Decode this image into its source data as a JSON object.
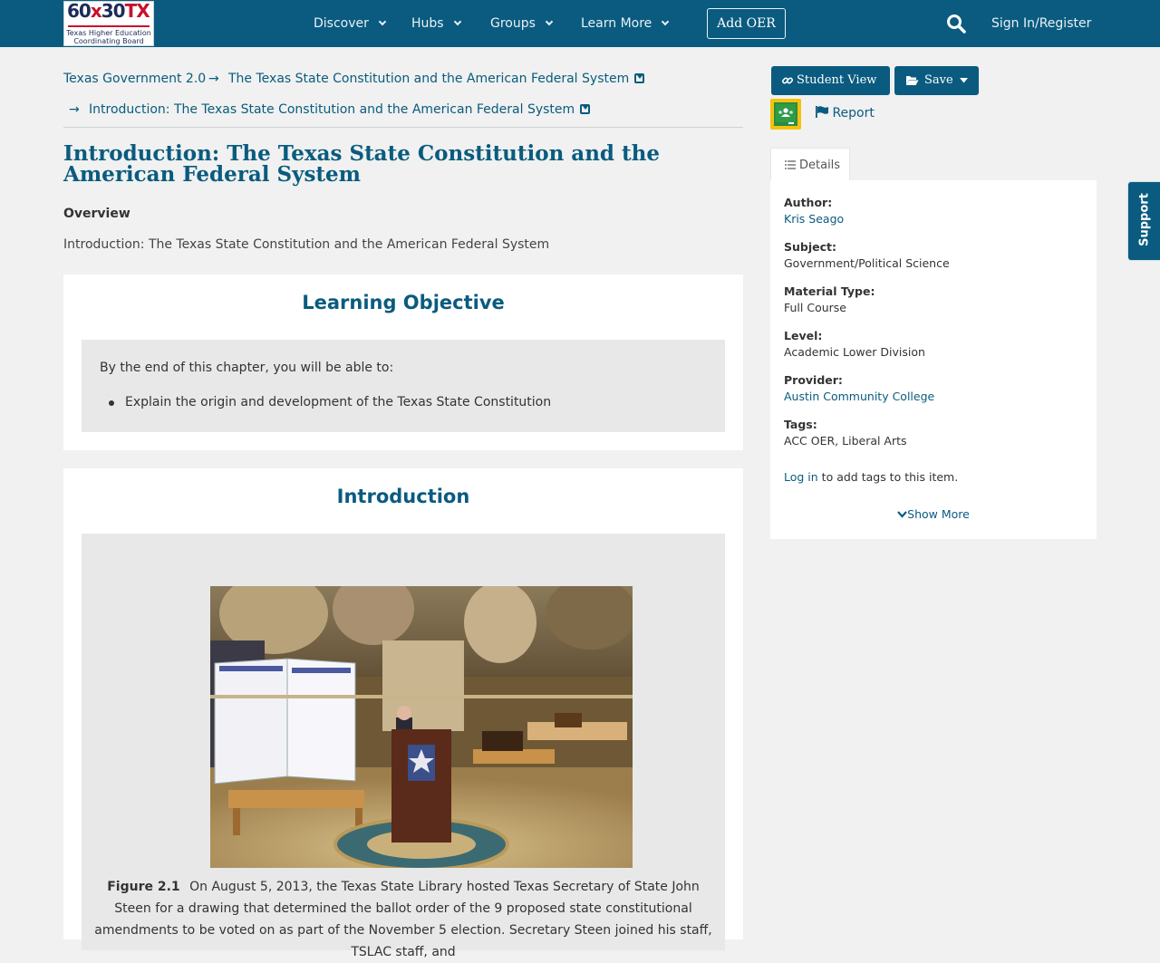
{
  "brand": {
    "logo_big_left": "60",
    "logo_big_x": "x",
    "logo_big_mid": "30",
    "logo_big_right": "TX",
    "logo_line1": "Texas Higher Education",
    "logo_line2": "Coordinating Board"
  },
  "nav": {
    "items": [
      "Discover",
      "Hubs",
      "Groups",
      "Learn More"
    ],
    "add_oer": "Add OER",
    "sign_in": "Sign In/Register"
  },
  "breadcrumb": {
    "items": [
      "Texas Government 2.0",
      "The Texas State Constitution and the American Federal System",
      "Introduction: The Texas State Constitution and the American Federal System"
    ],
    "separator": "→"
  },
  "page": {
    "title": "Introduction: The Texas State Constitution and the American Federal System",
    "overview_heading": "Overview",
    "overview_text": "Introduction: The Texas State Constitution and the American Federal System"
  },
  "learning_objective": {
    "title": "Learning Objective",
    "intro": "By the end of this chapter, you will be able to:",
    "bullets": [
      "Explain the origin and development of the Texas State Constitution"
    ]
  },
  "introduction": {
    "title": "Introduction",
    "figure_label": "Figure 2.1",
    "caption": "On August 5, 2013, the Texas State Library hosted Texas Secretary of State John Steen for a drawing that determined the ballot order of the 9 proposed state constitutional amendments to be voted on as part of the November 5 election. Secretary Steen joined his staff, TSLAC staff, and"
  },
  "actions": {
    "student_view": "Student View",
    "save": "Save",
    "report": "Report"
  },
  "details": {
    "tab": "Details",
    "author_label": "Author:",
    "author": "Kris Seago",
    "subject_label": "Subject:",
    "subject": "Government/Political Science",
    "material_label": "Material Type:",
    "material": "Full Course",
    "level_label": "Level:",
    "level": "Academic Lower Division",
    "provider_label": "Provider:",
    "provider": "Austin Community College",
    "tags_label": "Tags:",
    "tags": "ACC OER, Liberal Arts",
    "login_link": "Log in",
    "login_rest": " to add tags to this item.",
    "show_more": "Show More"
  },
  "support": "Support",
  "icons": {
    "search": "search-icon",
    "link": "link-icon",
    "folder": "folder-open-icon",
    "flag": "flag-icon",
    "list": "list-icon",
    "classroom": "google-classroom-icon"
  },
  "colors": {
    "primary": "#0a5b7f",
    "background": "#f0f1f0",
    "box_gray": "#e8e8e8",
    "classroom_yellow": "#f4c20d"
  }
}
